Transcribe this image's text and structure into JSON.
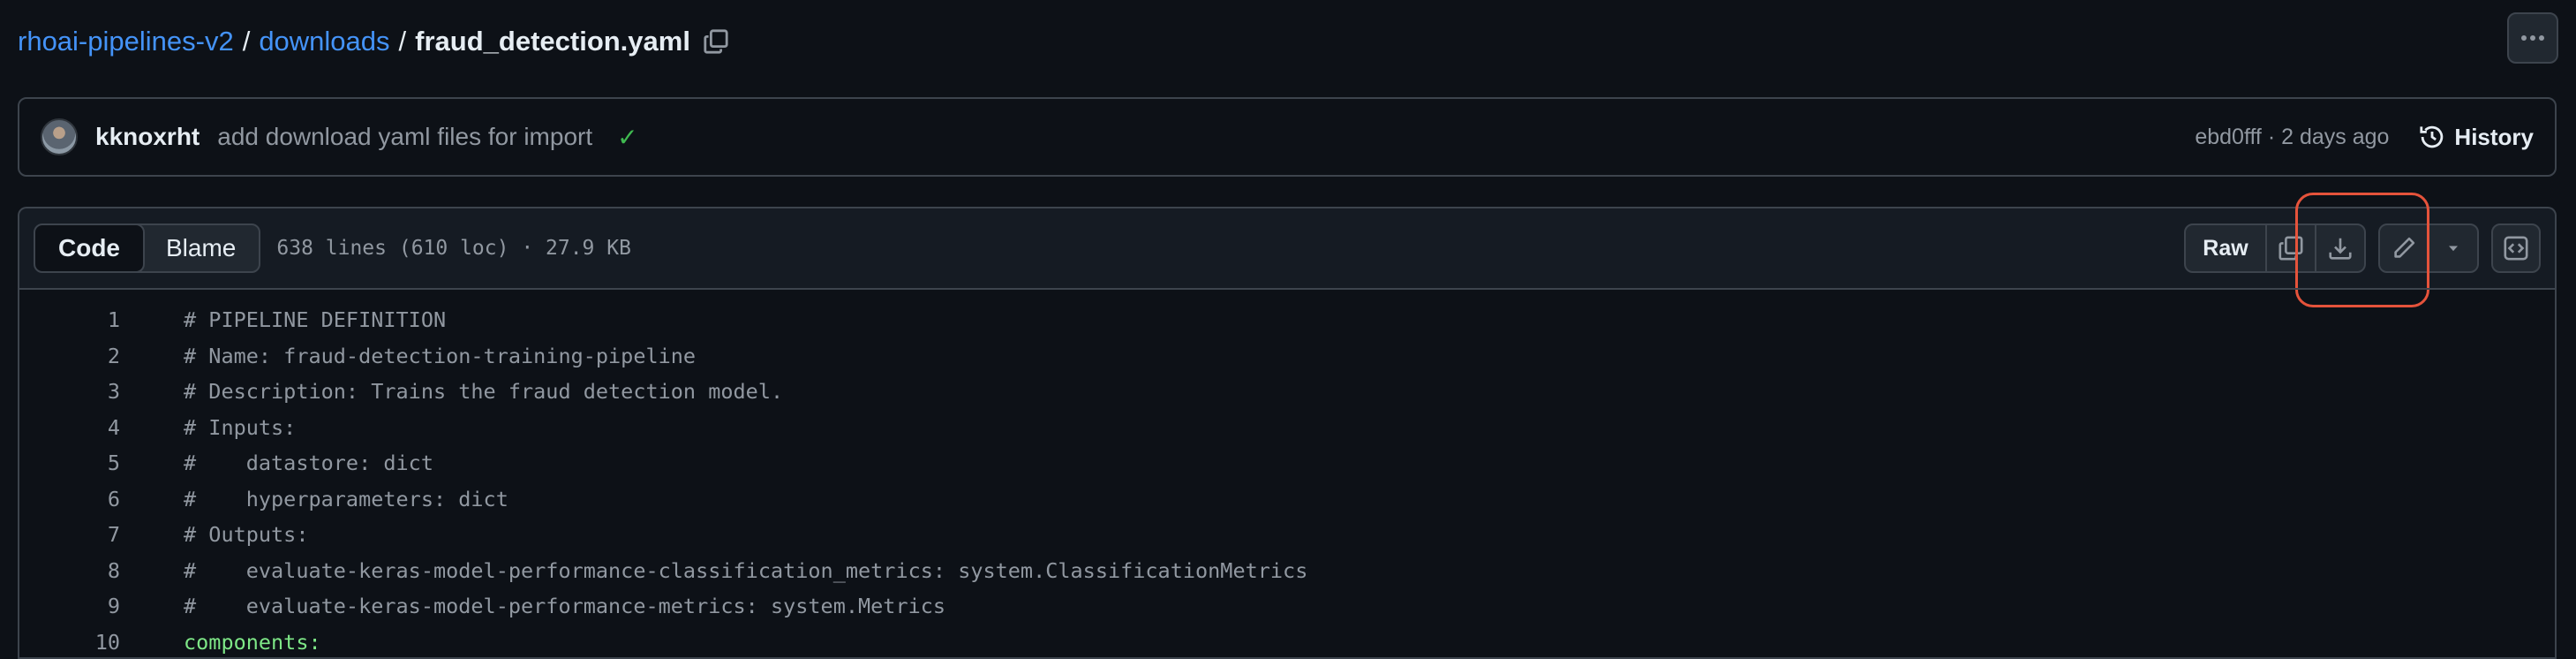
{
  "breadcrumb": {
    "repo": "rhoai-pipelines-v2",
    "folder": "downloads",
    "separator": "/",
    "file": "fraud_detection.yaml"
  },
  "commit": {
    "author": "kknoxrht",
    "message": "add download yaml files for import",
    "status": "✓",
    "hash_time": "ebd0fff · 2 days ago",
    "history_label": "History"
  },
  "file_header": {
    "tabs": [
      {
        "label": "Code",
        "active": true
      },
      {
        "label": "Blame",
        "active": false
      }
    ],
    "meta": "638 lines (610 loc) · 27.9 KB",
    "raw_label": "Raw"
  },
  "code": {
    "lines": [
      {
        "n": "1",
        "text": "# PIPELINE DEFINITION"
      },
      {
        "n": "2",
        "text": "# Name: fraud-detection-training-pipeline"
      },
      {
        "n": "3",
        "text": "# Description: Trains the fraud detection model."
      },
      {
        "n": "4",
        "text": "# Inputs:"
      },
      {
        "n": "5",
        "text": "#    datastore: dict"
      },
      {
        "n": "6",
        "text": "#    hyperparameters: dict"
      },
      {
        "n": "7",
        "text": "# Outputs:"
      },
      {
        "n": "8",
        "text": "#    evaluate-keras-model-performance-classification_metrics: system.ClassificationMetrics"
      },
      {
        "n": "9",
        "text": "#    evaluate-keras-model-performance-metrics: system.Metrics"
      },
      {
        "n": "10",
        "text": "components:"
      }
    ]
  },
  "icons": [
    "copy-icon",
    "kebab-icon",
    "check-icon",
    "history-icon",
    "download-icon",
    "pencil-icon",
    "triangle-down-icon",
    "code-square-icon"
  ],
  "colors": {
    "background": "#0d1117",
    "link": "#4493f8",
    "border": "#3d444d",
    "success": "#3fb950",
    "highlight": "#e5533b",
    "yaml_key": "#7ee787"
  }
}
